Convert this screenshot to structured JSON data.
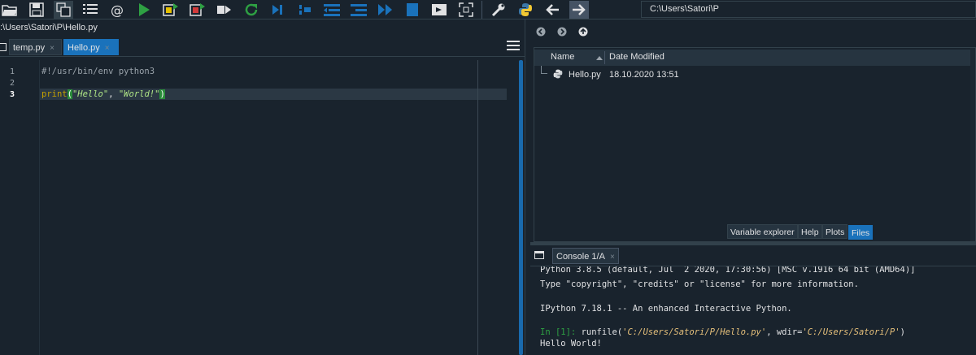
{
  "toolbar": {
    "icons": [
      "open-folder-icon",
      "save-icon",
      "save-all-icon",
      "list-icon",
      "at-icon",
      "run-icon",
      "run-cell-icon",
      "run-cell-advance-icon",
      "run-selection-icon",
      "restart-icon",
      "debug-step-icon",
      "debug-icon",
      "unindent-icon",
      "indent-icon",
      "continue-icon",
      "stop-icon",
      "maximize-pane-icon",
      "fullscreen-icon",
      "wrench-icon",
      "python-icon",
      "back-arrow-icon",
      "forward-arrow-icon"
    ],
    "path": "C:\\Users\\Satori\\P"
  },
  "editor": {
    "file_path": ":\\Users\\Satori\\P\\Hello.py",
    "tabs": [
      {
        "label": "temp.py",
        "close": "×"
      },
      {
        "label": "Hello.py",
        "close": "×"
      }
    ],
    "line_numbers": [
      "1",
      "2",
      "3"
    ],
    "lines": {
      "line1": "#!/usr/bin/env python3",
      "line3_func": "print",
      "line3_open": "(",
      "line3_str1": "\"Hello\"",
      "line3_sep": ", ",
      "line3_str2": "\"World!\"",
      "line3_close": ")"
    }
  },
  "files": {
    "columns": {
      "name": "Name",
      "date": "Date Modified"
    },
    "rows": [
      {
        "name": "Hello.py",
        "date": "18.10.2020 13:51"
      }
    ]
  },
  "pane_tabs": [
    "Variable explorer",
    "Help",
    "Plots",
    "Files"
  ],
  "console": {
    "tab_label": "Console 1/A",
    "tab_close": "×",
    "line1": "Python 3.8.5 (default, Jul  2 2020, 17:30:56) [MSC v.1916 64 bit (AMD64)]",
    "line2": "Type \"copyright\", \"credits\" or \"license\" for more information.",
    "line3": "IPython 7.18.1 -- An enhanced Interactive Python.",
    "prompt": "In [1]:",
    "cmd1": " runfile(",
    "cmd_arg1": "'C:/Users/Satori/P/Hello.py'",
    "cmd2": ", wdir=",
    "cmd_arg2": "'C:/Users/Satori/P'",
    "cmd3": ")",
    "output": "Hello World!"
  }
}
